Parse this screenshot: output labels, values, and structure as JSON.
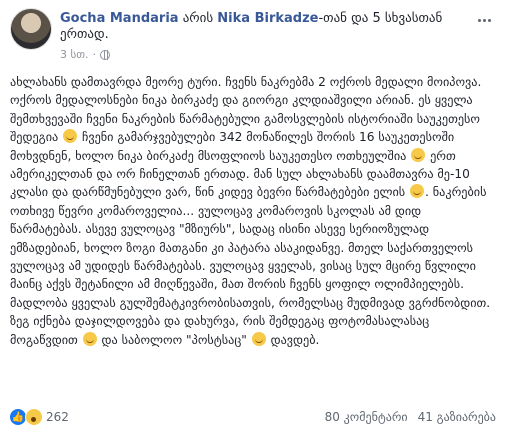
{
  "post": {
    "author": "Gocha Mandaria",
    "action_is": "არის",
    "tagged_person": "Nika Birkadze",
    "with_suffix": "-თან და 5 სხვასთან",
    "together": "ერთად.",
    "time": "3 სთ.",
    "body": "ახლახანს დამთავრდა მეორე ტური. ჩვენს ნაკრებმა 2 ოქროს მედალი მოიპოვა. ოქროს მედალოსნები ნიკა ბირკაძე და გიორგი კლდიაშვილი არიან. ეს ყველა შემთხვევაში ჩვენი ნაკრების წარმატებული გამოსვლების ისტორიაში საუკეთესო შედეგია",
    "body_2": " ჩვენი გამარჯვებულები 342 მონაწილეს შორის 16 საუკეთესოში მოხვდნენ, ხოლო ნიკა ბირკაძე მსოფლიოს საუკეთესო ოთხეულშია",
    "body_3": " ერთ ამერიკელთან და ორ ჩინელთან ერთად. მან სულ ახლახანს დაამთავრა მე-10 კლასი და დარწმუნებული ვარ, წინ კიდევ ბევრი წარმატებები ელის",
    "body_4": ". ნაკრების ოთხივე წევრი კომაროველია... ვულოცავ კომაროვის სკოლას ამ დიდ წარმატებას. ასევე ვულოცავ \"მზიურს\", სადაც ისინი ასევე სერიოზულად ემზადებიან, ხოლო ზოგი მათგანი კი პატარა ასაკიდანვე. მთელ საქართველოს ვულოცავ ამ უდიდეს წარმატებას. ვულოცავ ყველას, ვისაც სულ მცირე წვლილი მაინც აქვს შეტანილი ამ მიღწევაში, მათ შორის ჩვენს ყოფილ ოლიმპიელებს. მადლობა ყველას გულშემატკივრობისათვის, რომელსაც მუდმივად ვგრძნობდით. ზეგ იქნება დაჯილდოვება და დახურვა, რის შემდეგაც ფოტომასალასაც მოგაწვდით",
    "body_5": " და საბოლოო \"პოსტსაც\"",
    "body_6": " დავდებ.",
    "reactions_count": "262",
    "comments": "80 კომენტარი",
    "shares": "41 გაზიარება"
  },
  "colors": {
    "link": "#385898",
    "like": "#1877f2",
    "emoji": "#f7c948"
  }
}
